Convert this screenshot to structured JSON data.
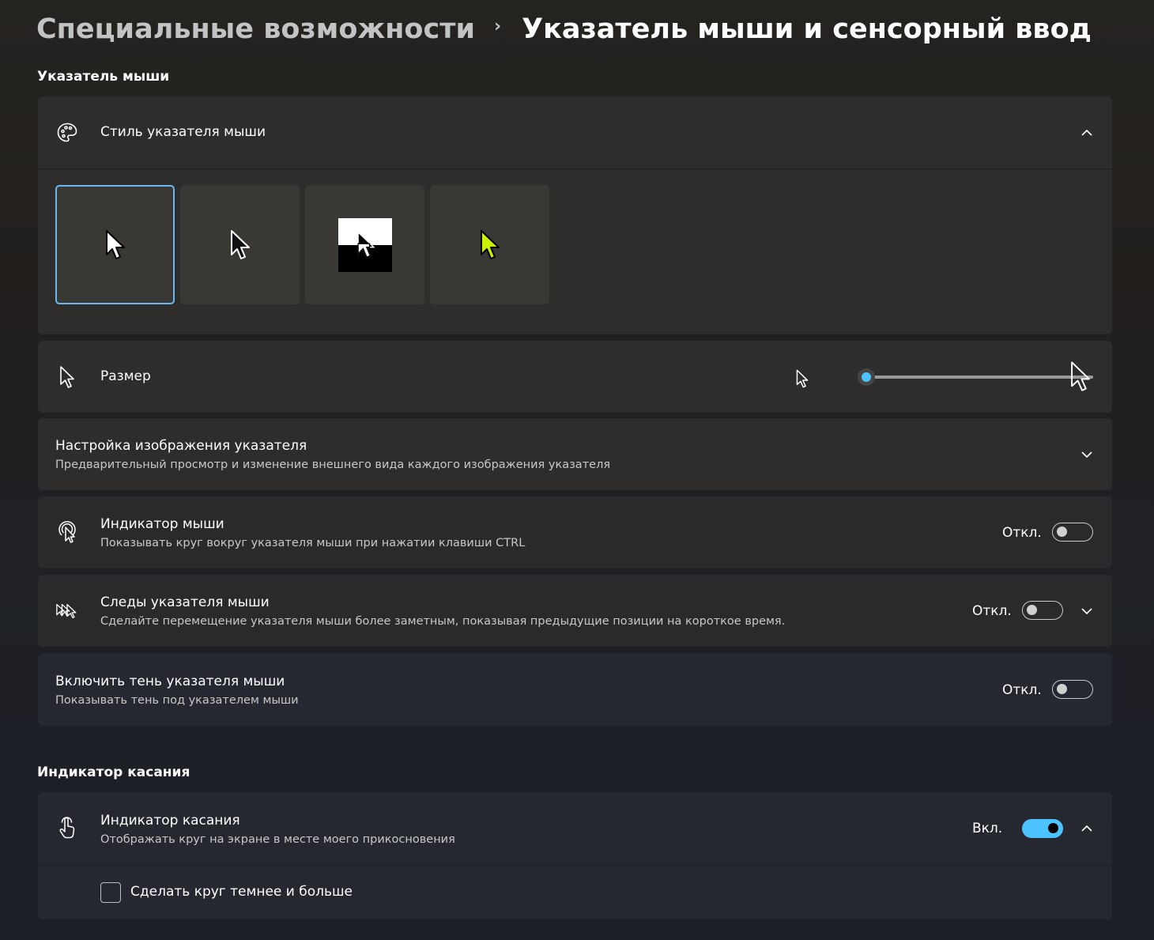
{
  "breadcrumb": {
    "parent": "Специальные возможности",
    "separator": "›",
    "current": "Указатель мыши и сенсорный ввод"
  },
  "mouse_section": {
    "title": "Указатель мыши",
    "pointer_style": {
      "title": "Стиль указателя мыши",
      "icon": "palette-icon",
      "expanded": true,
      "styles": [
        {
          "name": "white",
          "selected": true
        },
        {
          "name": "black",
          "selected": false
        },
        {
          "name": "inverted",
          "selected": false
        },
        {
          "name": "custom",
          "selected": false,
          "color": "#c8f000"
        }
      ]
    },
    "size": {
      "title": "Размер",
      "icon": "pointer-icon",
      "level": 0
    },
    "pointer_images": {
      "title": "Настройка изображения указателя",
      "desc": "Предварительный просмотр и изменение внешнего вида каждого изображения указателя"
    },
    "mouse_indicator": {
      "title": "Индикатор мыши",
      "desc": "Показывать круг вокруг указателя мыши при нажатии клавиши CTRL",
      "state": "Откл.",
      "on": false
    },
    "pointer_trails": {
      "title": "Следы указателя мыши",
      "desc": "Сделайте перемещение указателя мыши более заметным, показывая предыдущие позиции на короткое время.",
      "state": "Откл.",
      "on": false
    },
    "pointer_shadow": {
      "title": "Включить тень указателя мыши",
      "desc": "Показывать тень под указателем мыши",
      "state": "Откл.",
      "on": false
    }
  },
  "touch_section": {
    "title": "Индикатор касания",
    "touch_indicator": {
      "title": "Индикатор касания",
      "desc": "Отображать круг на экране в месте моего прикосновения",
      "state": "Вкл.",
      "on": true
    },
    "darker_circle": {
      "label": "Сделать круг темнее и больше",
      "checked": false
    }
  },
  "colors": {
    "accent": "#4cc2ff",
    "selected_border": "#69b8f0"
  }
}
